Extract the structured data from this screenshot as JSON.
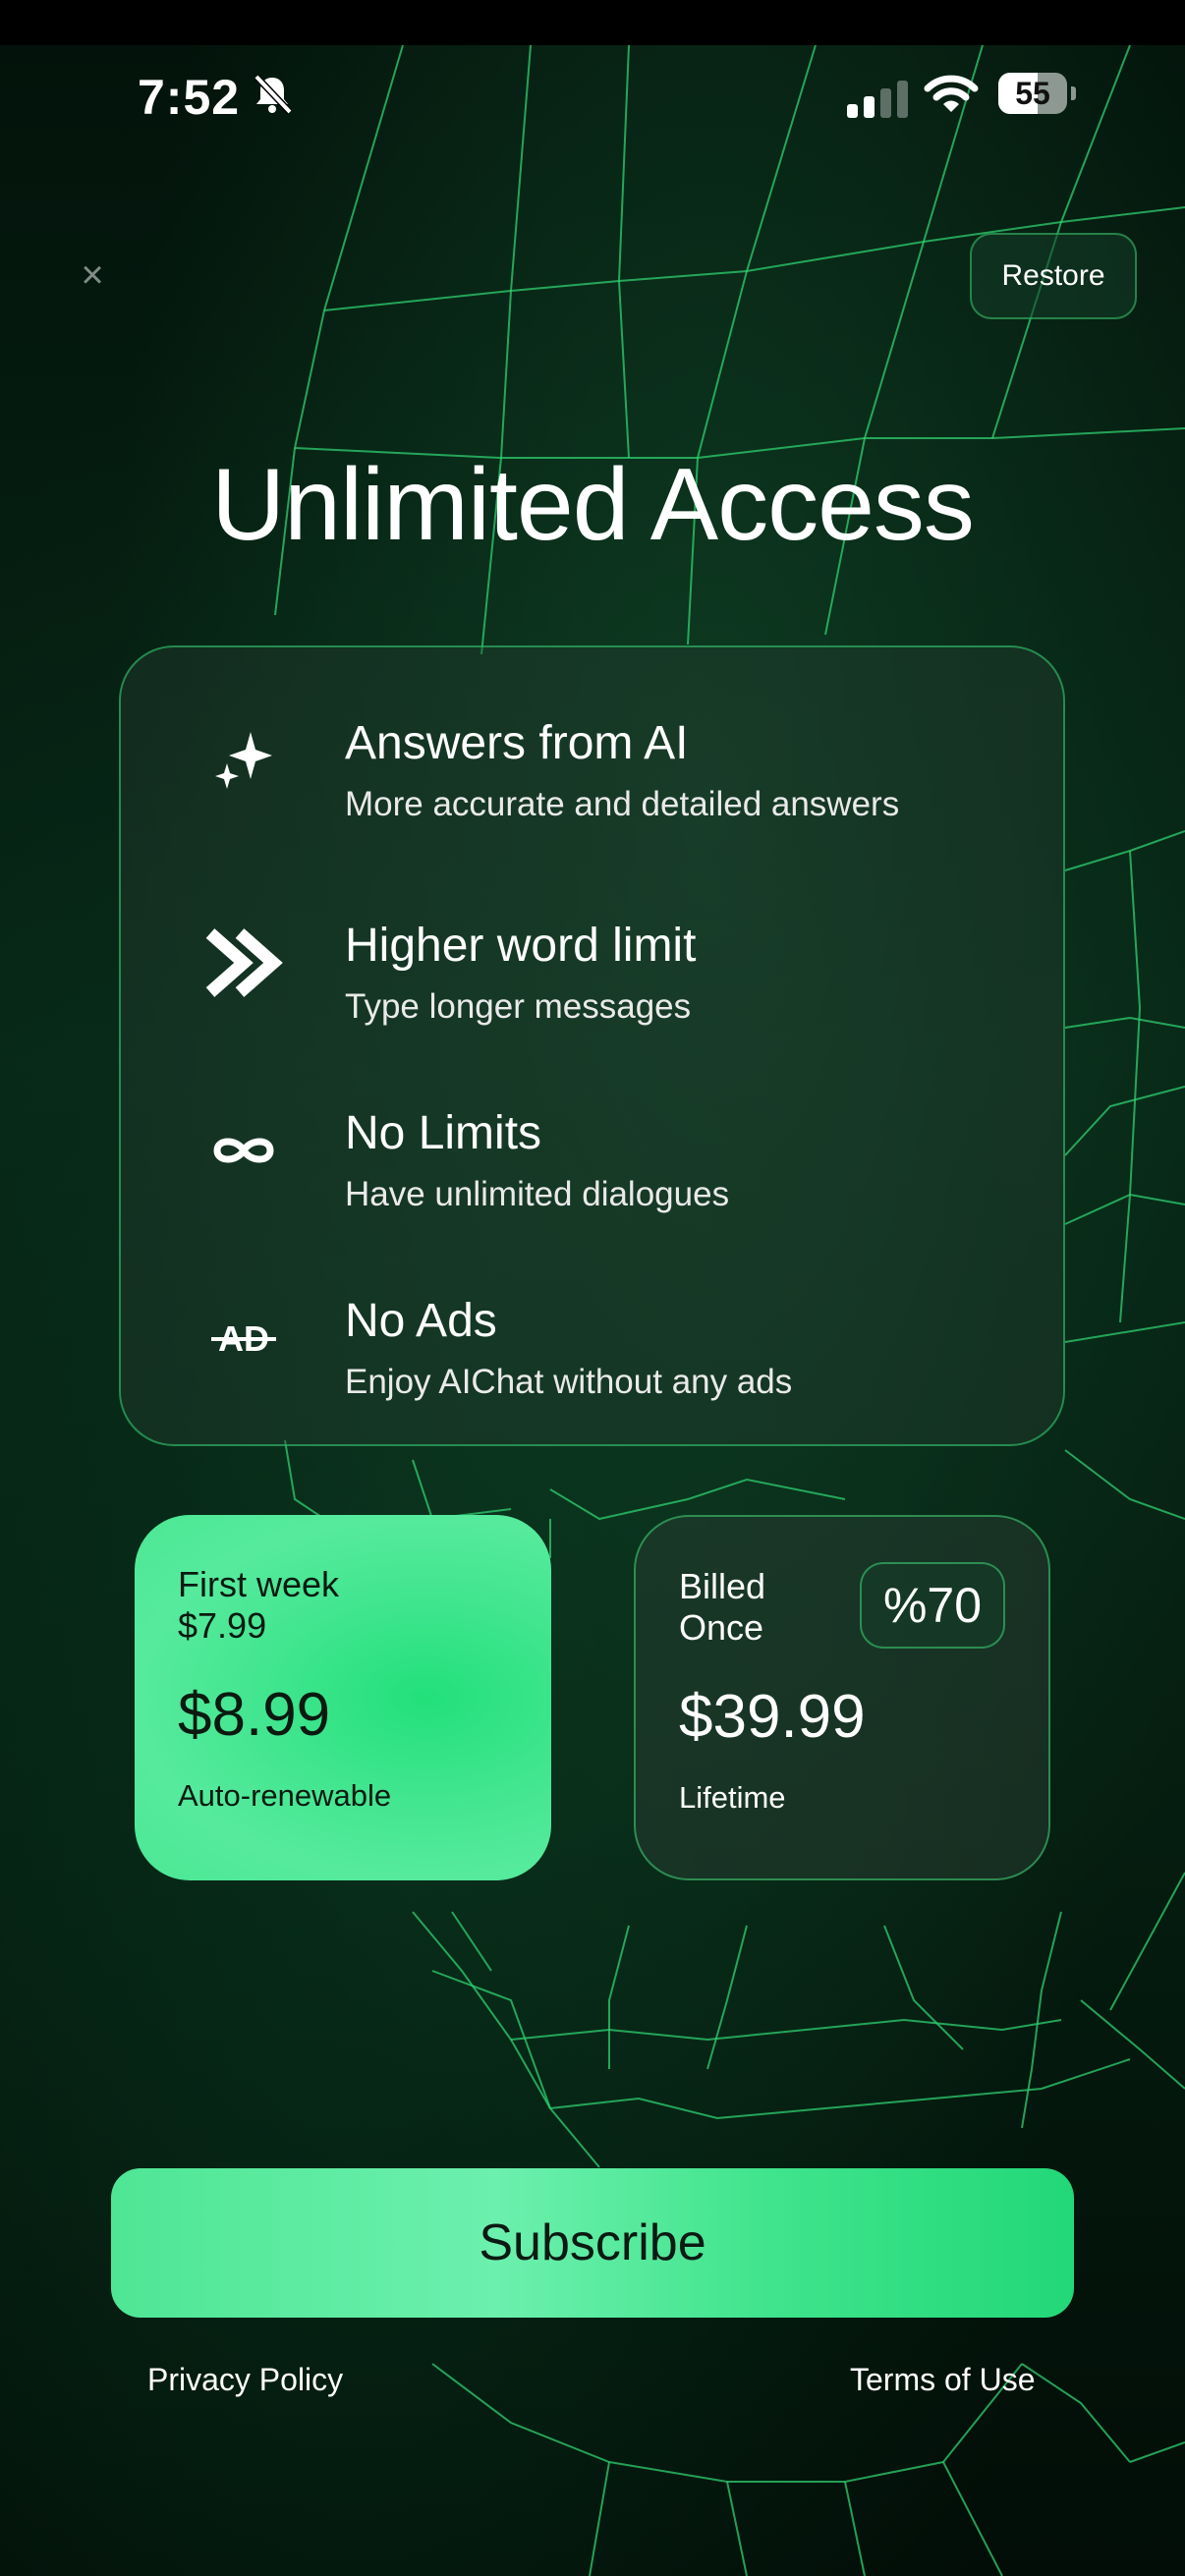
{
  "status_bar": {
    "time": "7:52",
    "battery": "55"
  },
  "header": {
    "close_label": "×",
    "restore_label": "Restore"
  },
  "title": "Unlimited Access",
  "features": [
    {
      "icon": "sparkles-icon",
      "title": "Answers from AI",
      "subtitle": "More accurate and detailed answers"
    },
    {
      "icon": "double-chevron-right-icon",
      "title": "Higher word limit",
      "subtitle": "Type longer messages"
    },
    {
      "icon": "infinity-icon",
      "title": "No Limits",
      "subtitle": "Have unlimited dialogues"
    },
    {
      "icon": "no-ads-icon",
      "icon_text": "AD",
      "title": "No Ads",
      "subtitle": "Enjoy AIChat without any ads"
    }
  ],
  "plans": {
    "weekly": {
      "line1": "First week",
      "line2": "$7.99",
      "price": "$8.99",
      "footer": "Auto-renewable",
      "selected": true
    },
    "lifetime": {
      "line1": "Billed",
      "line2": "Once",
      "badge": "%70",
      "price": "$39.99",
      "footer": "Lifetime",
      "selected": false
    }
  },
  "subscribe_label": "Subscribe",
  "links": {
    "privacy": "Privacy Policy",
    "terms": "Terms of Use"
  },
  "colors": {
    "accent": "#3ee58d",
    "border": "#32c86e",
    "background": "#062013"
  }
}
